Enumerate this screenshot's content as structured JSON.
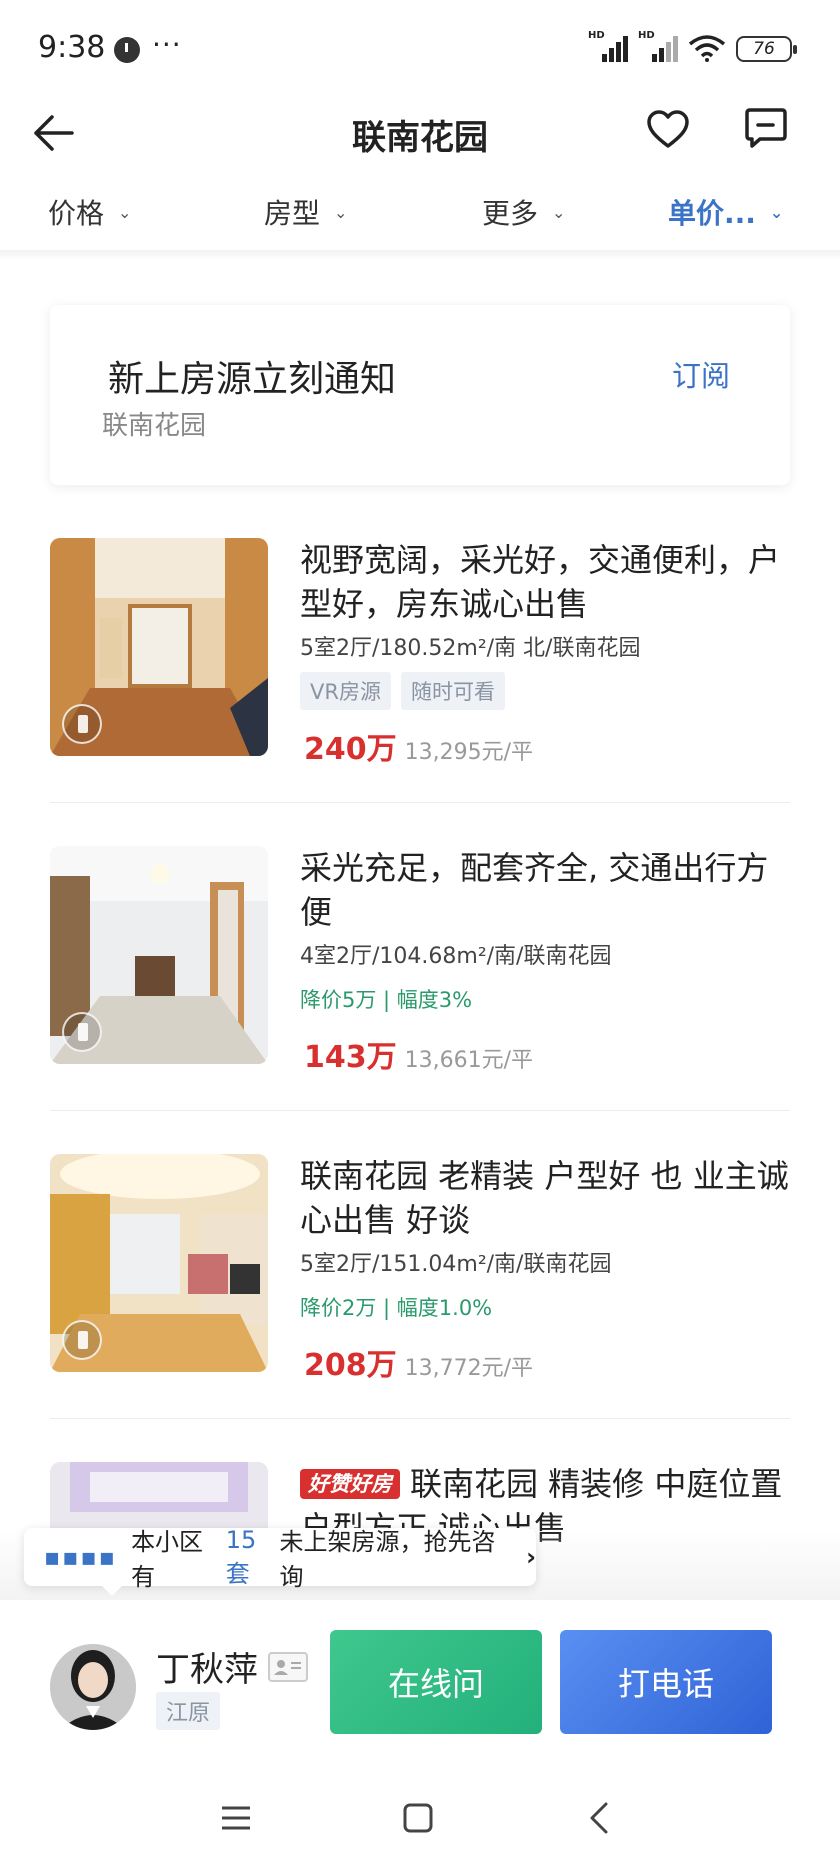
{
  "status_bar": {
    "time": "9:38",
    "more": "···",
    "battery": "76",
    "hd1": "HD",
    "hd2": "HD"
  },
  "nav": {
    "title": "联南花园"
  },
  "filters": [
    {
      "label": "价格",
      "active": false
    },
    {
      "label": "房型",
      "active": false
    },
    {
      "label": "更多",
      "active": false
    },
    {
      "label": "单价...",
      "active": true
    }
  ],
  "subscribe": {
    "title": "新上房源立刻通知",
    "subtitle": "联南花园",
    "button": "订阅"
  },
  "listings": [
    {
      "title": "视野宽阔，采光好，交通便利，户型好，房东诚心出售",
      "meta": "5室2厅/180.52m²/南 北/联南花园",
      "tags": [
        "VR房源",
        "随时可看"
      ],
      "price": "240万",
      "unit_price": "13,295元/平"
    },
    {
      "title": "采光充足，配套齐全, 交通出行方便",
      "meta": "4室2厅/104.68m²/南/联南花园",
      "price_drop": "降价5万 | 幅度3%",
      "price": "143万",
      "unit_price": "13,661元/平"
    },
    {
      "title": "联南花园 老精装 户型好 也 业主诚心出售 好谈",
      "meta": "5室2厅/151.04m²/南/联南花园",
      "price_drop": "降价2万 | 幅度1.0%",
      "price": "208万",
      "unit_price": "13,772元/平"
    },
    {
      "badge": "好赞好房",
      "title": "联南花园  精装修 中庭位置 户型方正 诚心出售"
    }
  ],
  "tooltip": {
    "dots": "▪▪▪▪",
    "prefix": "本小区有",
    "count": "15套",
    "suffix": "未上架房源，抢先咨询",
    "arrow": "›"
  },
  "agent": {
    "name": "丁秋萍",
    "company": "江原",
    "chat_button": "在线问",
    "call_button": "打电话"
  },
  "colors": {
    "accent": "#3b73c6",
    "price": "#d8302f",
    "drop": "#2a9a6c",
    "chat": "#23b07a",
    "call": "#2f63d6"
  }
}
